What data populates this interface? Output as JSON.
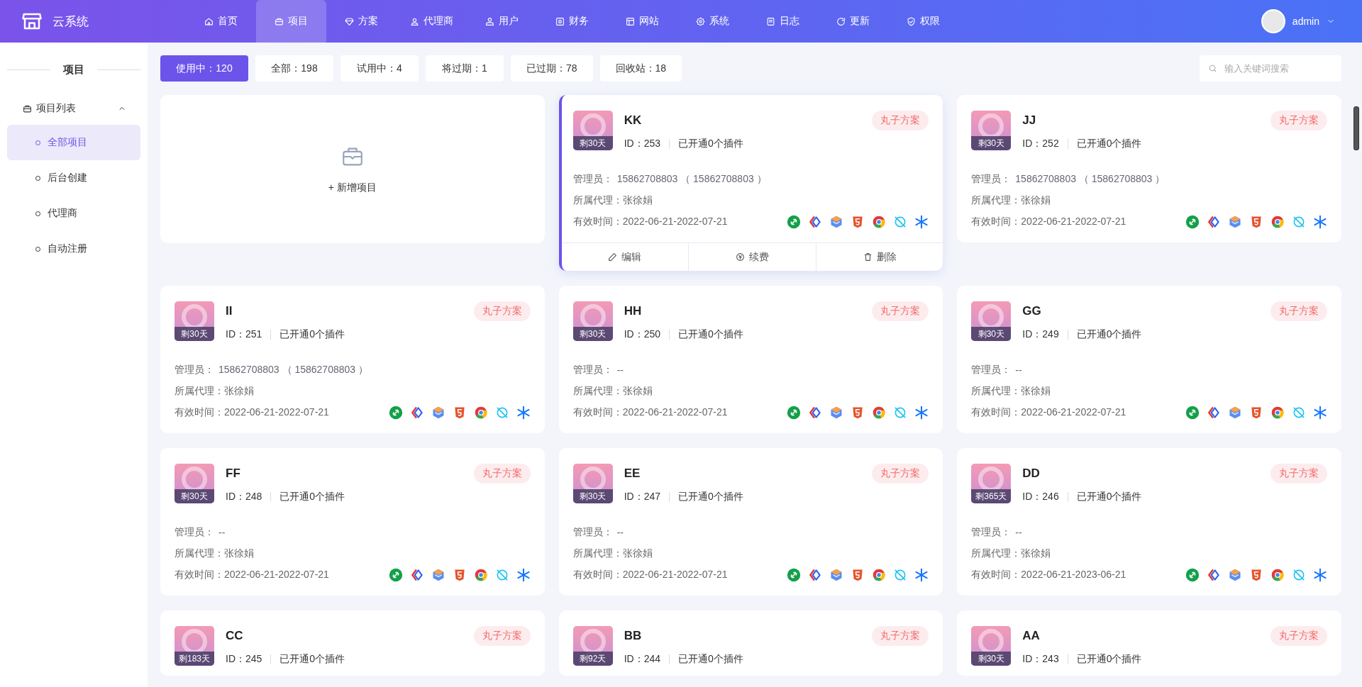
{
  "header": {
    "brand": "云系统",
    "nav": [
      {
        "label": "首页",
        "selected": false
      },
      {
        "label": "项目",
        "selected": true
      },
      {
        "label": "方案",
        "selected": false
      },
      {
        "label": "代理商",
        "selected": false
      },
      {
        "label": "用户",
        "selected": false
      },
      {
        "label": "财务",
        "selected": false
      },
      {
        "label": "网站",
        "selected": false
      },
      {
        "label": "系统",
        "selected": false
      },
      {
        "label": "日志",
        "selected": false
      },
      {
        "label": "更新",
        "selected": false
      },
      {
        "label": "权限",
        "selected": false
      }
    ],
    "user": {
      "name": "admin"
    }
  },
  "sidebar": {
    "title": "项目",
    "group": {
      "label": "项目列表",
      "expanded": true,
      "children": [
        {
          "label": "全部项目",
          "selected": true
        },
        {
          "label": "后台创建",
          "selected": false
        },
        {
          "label": "代理商",
          "selected": false
        },
        {
          "label": "自动注册",
          "selected": false
        }
      ]
    }
  },
  "filters": [
    {
      "label": "使用中：120",
      "selected": true
    },
    {
      "label": "全部：198",
      "selected": false
    },
    {
      "label": "试用中：4",
      "selected": false
    },
    {
      "label": "将过期：1",
      "selected": false
    },
    {
      "label": "已过期：78",
      "selected": false
    },
    {
      "label": "回收站：18",
      "selected": false
    }
  ],
  "search": {
    "placeholder": "输入关键词搜索"
  },
  "add_card": {
    "label": "+ 新增项目"
  },
  "cards": [
    {
      "name": "KK",
      "id": "ID：253",
      "plugins": "已开通0个插件",
      "remaining": "剩30天",
      "tag": "丸子方案",
      "admin_label": "管理员：",
      "admin": "15862708803 （ 15862708803 ）",
      "agent": "所属代理：张徐娟",
      "validity": "有效时间：2022-06-21-2022-07-21",
      "selected": true,
      "actions": [
        {
          "label": "编辑",
          "kind": "edit"
        },
        {
          "label": "续费",
          "kind": "renew"
        },
        {
          "label": "删除",
          "kind": "delete"
        }
      ]
    },
    {
      "name": "JJ",
      "id": "ID：252",
      "plugins": "已开通0个插件",
      "remaining": "剩30天",
      "tag": "丸子方案",
      "admin_label": "管理员：",
      "admin": "15862708803 （ 15862708803 ）",
      "agent": "所属代理：张徐娟",
      "validity": "有效时间：2022-06-21-2022-07-21",
      "selected": false
    },
    {
      "name": "II",
      "id": "ID：251",
      "plugins": "已开通0个插件",
      "remaining": "剩30天",
      "tag": "丸子方案",
      "admin_label": "管理员：",
      "admin": "15862708803 （ 15862708803 ）",
      "agent": "所属代理：张徐娟",
      "validity": "有效时间：2022-06-21-2022-07-21",
      "selected": false
    },
    {
      "name": "HH",
      "id": "ID：250",
      "plugins": "已开通0个插件",
      "remaining": "剩30天",
      "tag": "丸子方案",
      "admin_label": "管理员：",
      "admin": "--",
      "agent": "所属代理：张徐娟",
      "validity": "有效时间：2022-06-21-2022-07-21",
      "selected": false
    },
    {
      "name": "GG",
      "id": "ID：249",
      "plugins": "已开通0个插件",
      "remaining": "剩30天",
      "tag": "丸子方案",
      "admin_label": "管理员：",
      "admin": "--",
      "agent": "所属代理：张徐娟",
      "validity": "有效时间：2022-06-21-2022-07-21",
      "selected": false
    },
    {
      "name": "FF",
      "id": "ID：248",
      "plugins": "已开通0个插件",
      "remaining": "剩30天",
      "tag": "丸子方案",
      "admin_label": "管理员：",
      "admin": "--",
      "agent": "所属代理：张徐娟",
      "validity": "有效时间：2022-06-21-2022-07-21",
      "selected": false
    },
    {
      "name": "EE",
      "id": "ID：247",
      "plugins": "已开通0个插件",
      "remaining": "剩30天",
      "tag": "丸子方案",
      "admin_label": "管理员：",
      "admin": "--",
      "agent": "所属代理：张徐娟",
      "validity": "有效时间：2022-06-21-2022-07-21",
      "selected": false
    },
    {
      "name": "DD",
      "id": "ID：246",
      "plugins": "已开通0个插件",
      "remaining": "剩365天",
      "tag": "丸子方案",
      "admin_label": "管理员：",
      "admin": "--",
      "agent": "所属代理：张徐娟",
      "validity": "有效时间：2022-06-21-2023-06-21",
      "selected": false
    },
    {
      "name": "CC",
      "id": "ID：245",
      "plugins": "已开通0个插件",
      "remaining": "剩183天",
      "tag": "丸子方案",
      "selected": false
    },
    {
      "name": "BB",
      "id": "ID：244",
      "plugins": "已开通0个插件",
      "remaining": "剩92天",
      "tag": "丸子方案",
      "selected": false
    },
    {
      "name": "AA",
      "id": "ID：243",
      "plugins": "已开通0个插件",
      "remaining": "剩30天",
      "tag": "丸子方案",
      "selected": false
    }
  ]
}
